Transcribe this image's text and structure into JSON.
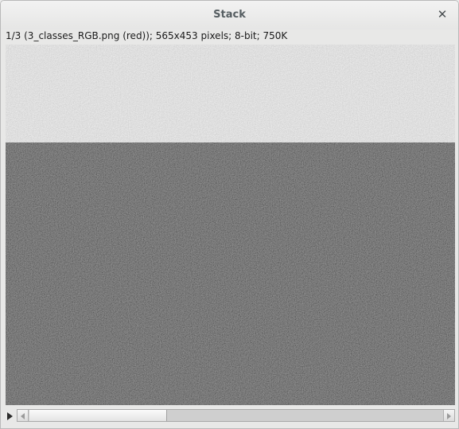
{
  "window": {
    "title": "Stack",
    "close_glyph": "✕"
  },
  "info_line": "1/3 (3_classes_RGB.png (red)); 565x453 pixels; 8-bit; 750K",
  "image": {
    "top_region_color": "#c4c4c4",
    "bottom_region_color": "#3c3c3c"
  },
  "slice_slider": {
    "current_slice": 1,
    "total_slices": 3,
    "play_icon": "play-icon",
    "left_arrow_icon": "arrow-left-icon",
    "right_arrow_icon": "arrow-right-icon"
  }
}
